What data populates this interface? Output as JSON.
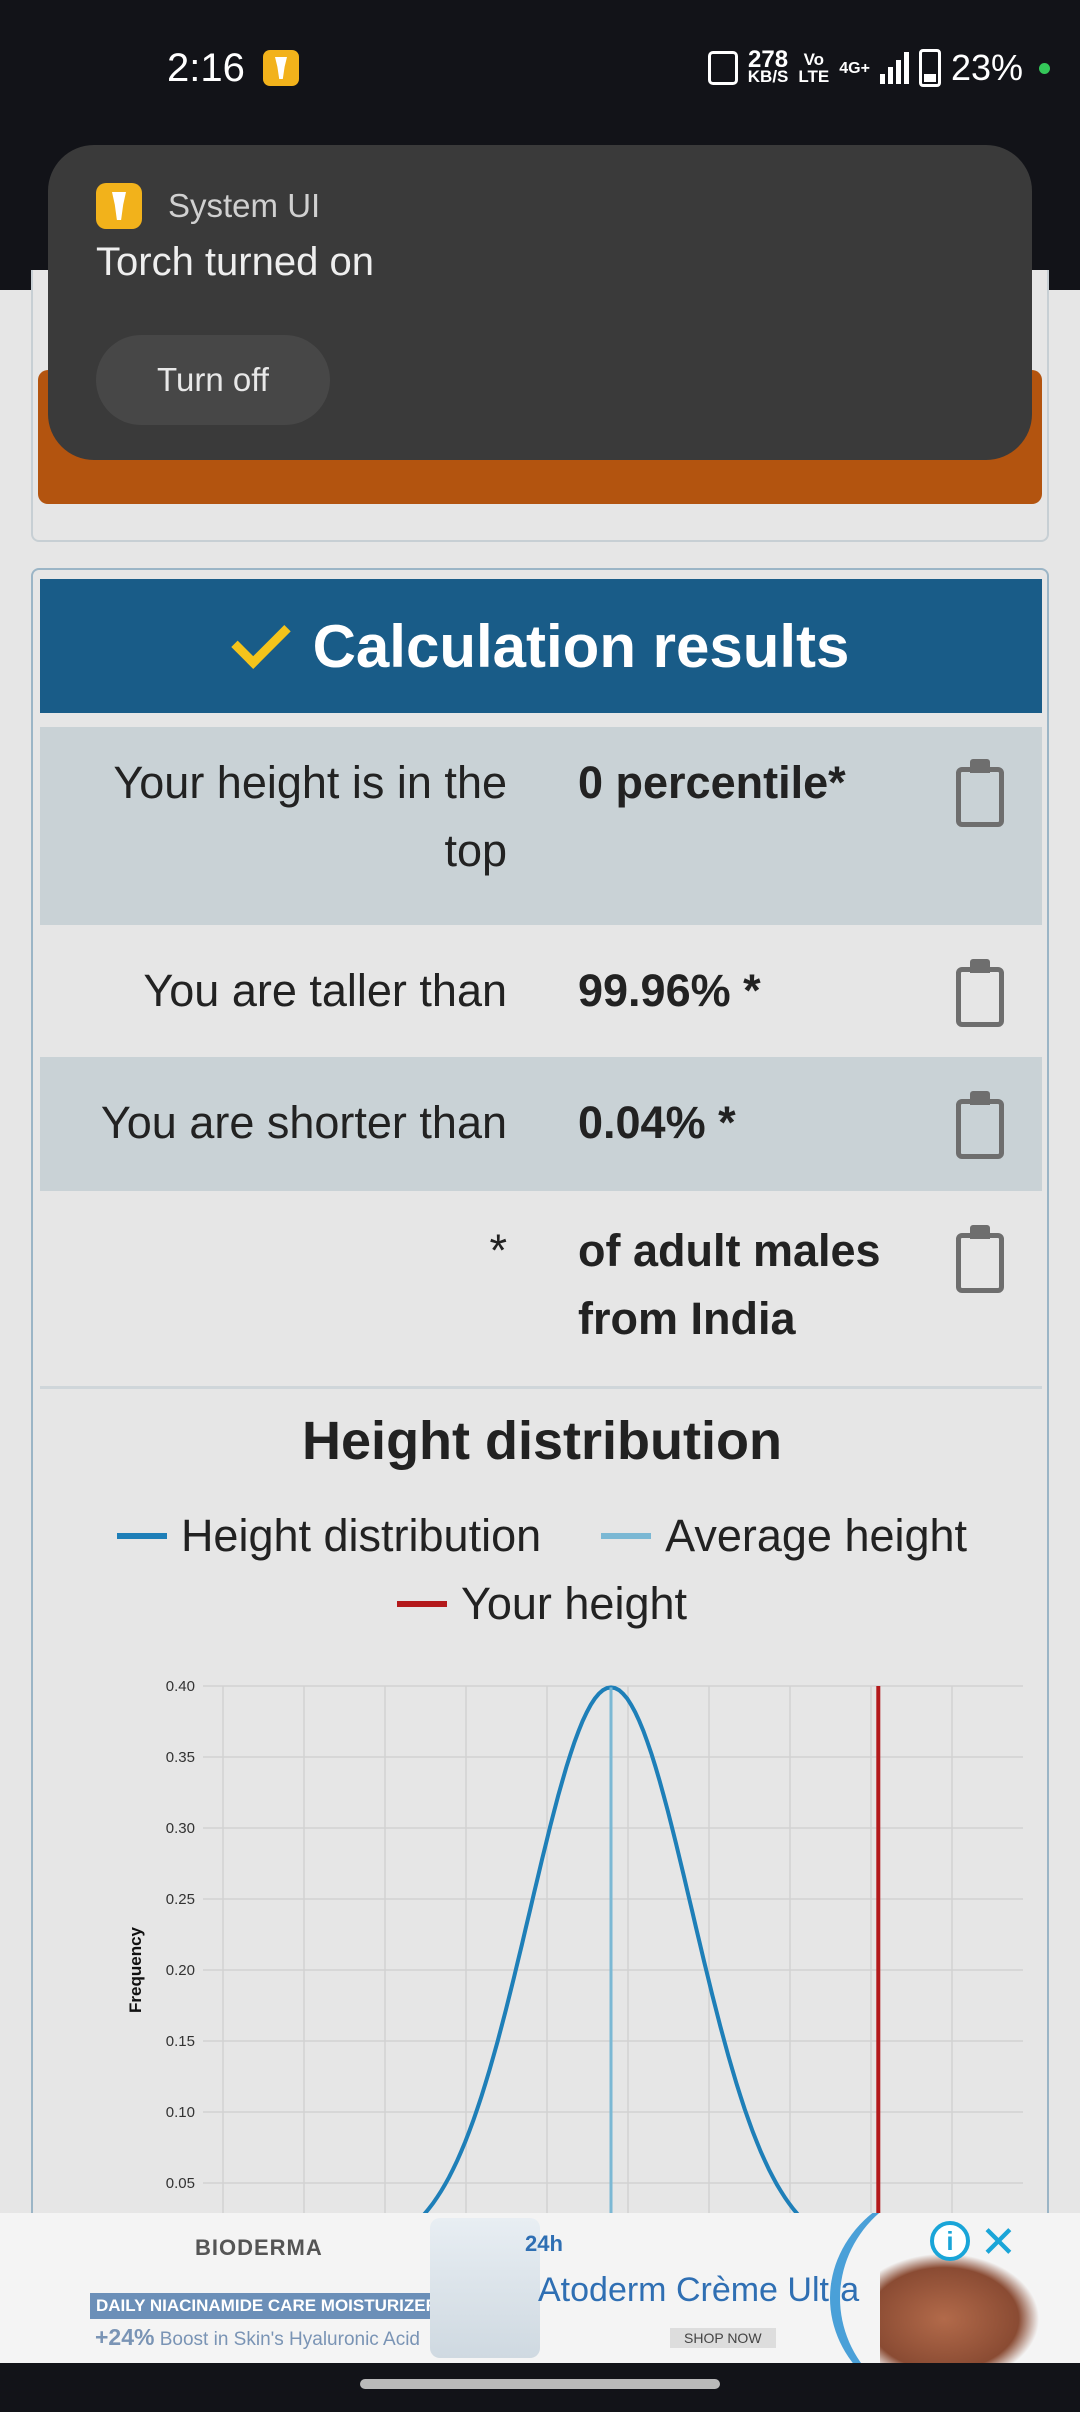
{
  "status_bar": {
    "time": "2:16",
    "net_speed_value": "278",
    "net_speed_unit": "KB/S",
    "volte_top": "Vo",
    "volte_bottom": "LTE",
    "network": "4G+",
    "battery": "23%"
  },
  "toast": {
    "app_name": "System UI",
    "message": "Torch turned on",
    "action_label": "Turn off"
  },
  "results": {
    "header_title": "Calculation results",
    "rows": [
      {
        "label": "Your height is in the top",
        "value": "0 percentile*"
      },
      {
        "label": "You are taller than",
        "value": "99.96% *"
      },
      {
        "label": "You are shorter than",
        "value": "0.04% *"
      },
      {
        "label": "*",
        "value": "of adult males from India"
      }
    ]
  },
  "distribution": {
    "title": "Height distribution",
    "legend": [
      {
        "label": "Height distribution",
        "color": "#1e7fb8"
      },
      {
        "label": "Average height",
        "color": "#7bb8d4"
      },
      {
        "label": "Your height",
        "color": "#b3191b"
      }
    ]
  },
  "chart_data": {
    "type": "line",
    "title": "Height distribution",
    "ylabel": "Frequency",
    "xlabel": "",
    "ylim": [
      0.0,
      0.4
    ],
    "y_ticks": [
      "0.40",
      "0.35",
      "0.30",
      "0.25",
      "0.20",
      "0.15",
      "0.10",
      "0.05"
    ],
    "grid": true,
    "series": [
      {
        "name": "Height distribution",
        "type": "normal_curve",
        "peak": 0.399,
        "x": [
          -4,
          -3.5,
          -3,
          -2.5,
          -2,
          -1.5,
          -1,
          -0.5,
          0,
          0.5,
          1,
          1.5,
          2,
          2.5,
          3,
          3.5,
          4
        ],
        "values": [
          0.0001,
          0.0009,
          0.0044,
          0.0175,
          0.054,
          0.1295,
          0.242,
          0.3521,
          0.399,
          0.3521,
          0.242,
          0.1295,
          0.054,
          0.0175,
          0.0044,
          0.0009,
          0.0001
        ]
      },
      {
        "name": "Average height",
        "x": 0
      },
      {
        "name": "Your height",
        "x": 3.3
      }
    ],
    "colors": {
      "curve": "#1e7fb8",
      "average": "#7bb8d4",
      "yours": "#b3191b"
    }
  },
  "ad": {
    "brand": "BIODERMA",
    "tagline": "DAILY NIACINAMIDE CARE MOISTURIZER",
    "sub_bold": "+24%",
    "sub_text": "Boost in Skin's Hyaluronic Acid",
    "badge": "24h",
    "product": "Atoderm Crème Ultra",
    "cta": "SHOP NOW",
    "info_icon": "info-icon",
    "close_icon": "close-icon"
  }
}
